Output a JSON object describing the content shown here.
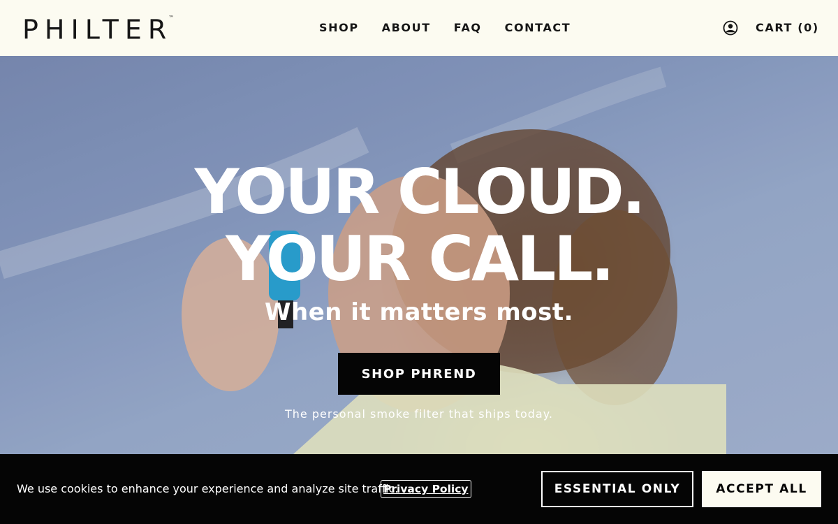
{
  "header": {
    "logo_text": "PHILTER",
    "logo_tm": "™",
    "nav": [
      {
        "label": "SHOP"
      },
      {
        "label": "ABOUT"
      },
      {
        "label": "FAQ"
      },
      {
        "label": "CONTACT"
      }
    ],
    "account_icon": "user-circle-icon",
    "cart_label": "CART (0)"
  },
  "hero": {
    "headline_line1": "YOUR CLOUD.",
    "headline_line2": "YOUR CALL.",
    "subhead": "When it matters most.",
    "cta_label": "SHOP PHREND",
    "tagline": "The personal smoke filter that ships today."
  },
  "cookie_banner": {
    "message": "We use cookies to enhance your experience and analyze site traffic.",
    "privacy_link": "Privacy Policy",
    "essential_label": "ESSENTIAL ONLY",
    "accept_label": "ACCEPT ALL"
  },
  "colors": {
    "header_bg": "#fcfbf1",
    "text_dark": "#161616",
    "banner_bg": "#050505",
    "hero_sky": "#8b9fc4"
  }
}
